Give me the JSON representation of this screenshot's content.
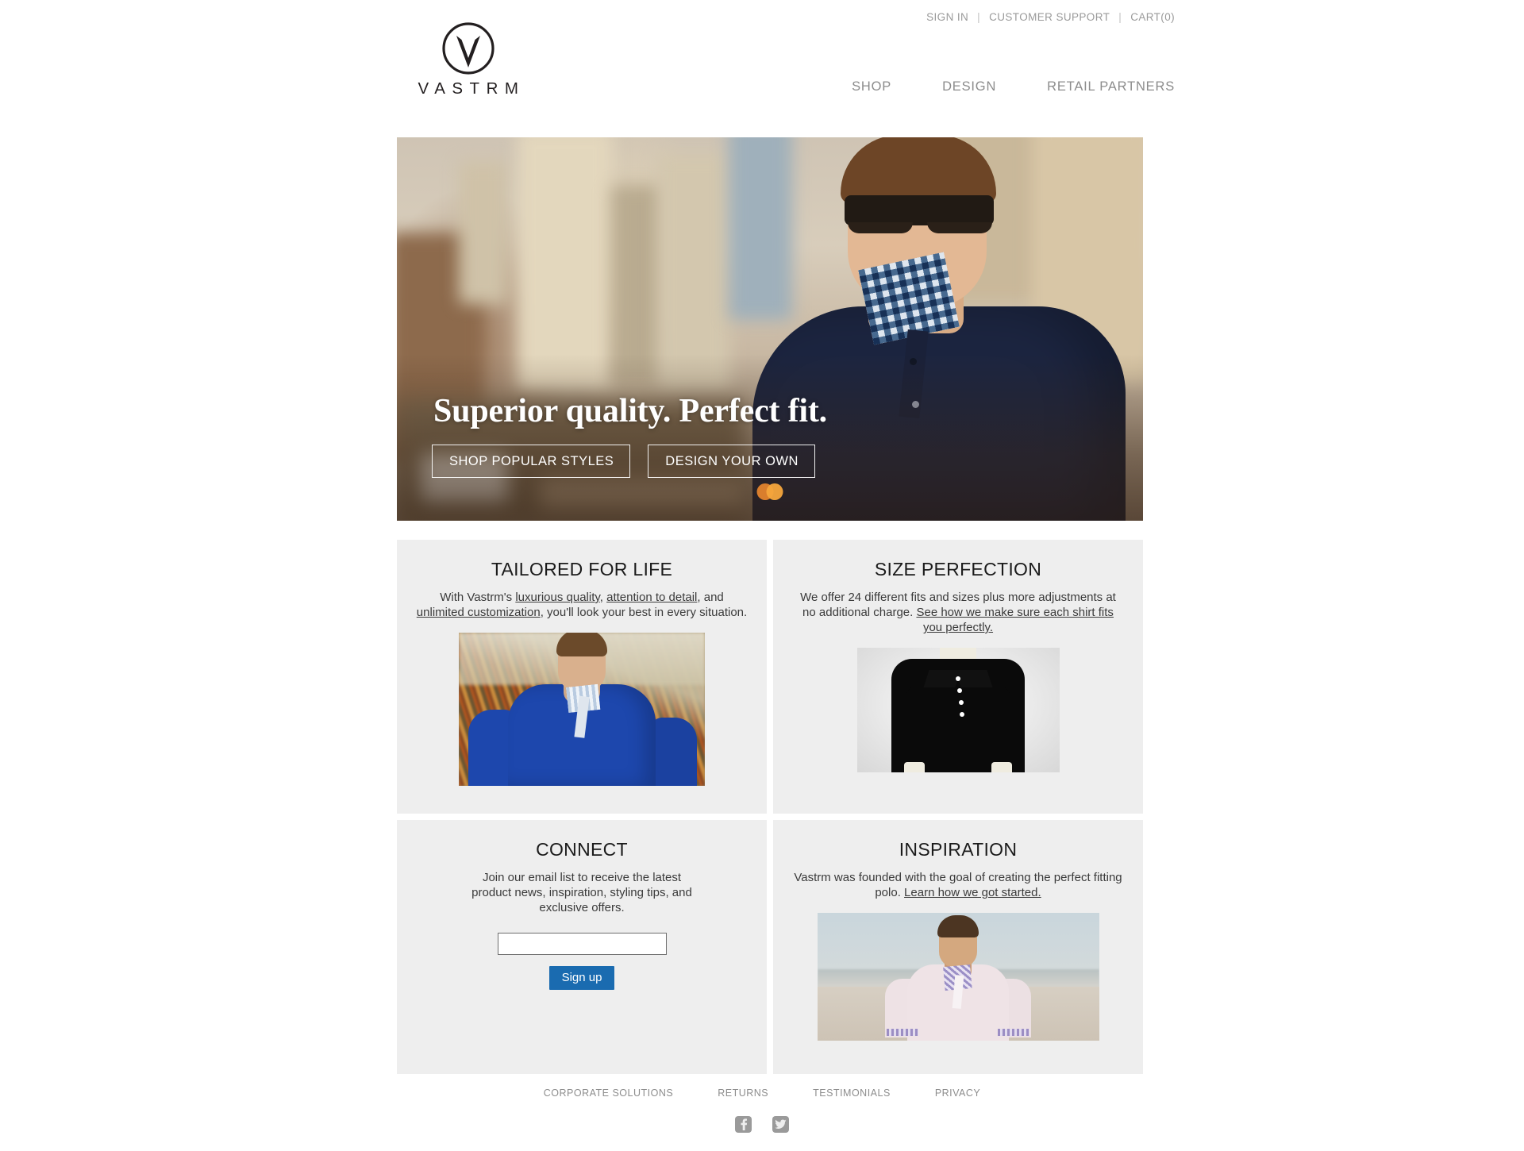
{
  "utility": {
    "sign_in": "SIGN IN",
    "customer_support": "CUSTOMER SUPPORT",
    "cart": "CART(0)",
    "separator": "|"
  },
  "brand": {
    "wordmark": "VASTRM",
    "logo_icon": "circle-v-monogram-icon"
  },
  "nav": {
    "items": [
      {
        "label": "SHOP"
      },
      {
        "label": "DESIGN"
      },
      {
        "label": "RETAIL PARTNERS"
      }
    ]
  },
  "hero": {
    "headline": "Superior quality. Perfect fit.",
    "primary_button": "SHOP POPULAR STYLES",
    "secondary_button": "DESIGN YOUR OWN",
    "image_alt": "man-in-navy-polo-with-gingham-collar-city-street",
    "carousel": {
      "slides": 2,
      "active": 1,
      "dot_color_a": "#e8872e",
      "dot_color_b": "#f5a73c"
    }
  },
  "panels": {
    "tailored": {
      "title": "TAILORED FOR LIFE",
      "body_1": "With Vastrm's ",
      "link_1": "luxurious quality",
      "body_2": ", ",
      "link_2": "attention to detail",
      "body_3": ", and ",
      "link_3": "unlimited customization",
      "body_4": ", you'll look your best in every situation.",
      "image_alt": "man-in-blue-polo-outdoors"
    },
    "size": {
      "title": "SIZE PERFECTION",
      "body_1": "We offer 24 different fits and sizes plus more adjustments at no additional charge. ",
      "link_1": "See how we make sure each shirt fits you perfectly.",
      "image_alt": "black-polo-shirt-on-mannequin"
    },
    "connect": {
      "title": "CONNECT",
      "body": "Join our email list to receive the latest product news, inspiration, styling tips, and exclusive offers.",
      "email_value": "",
      "email_placeholder": "",
      "signup_label": "Sign up",
      "signup_color": "#1a6bb0"
    },
    "inspiration": {
      "title": "INSPIRATION",
      "body_1": "Vastrm was founded with the goal of creating the perfect fitting polo. ",
      "link_1": "Learn how we got started.",
      "image_alt": "man-in-light-pink-polo-on-beach"
    }
  },
  "footer": {
    "links": [
      {
        "label": "CORPORATE SOLUTIONS"
      },
      {
        "label": "RETURNS"
      },
      {
        "label": "TESTIMONIALS"
      },
      {
        "label": "PRIVACY"
      }
    ],
    "social": [
      {
        "name": "facebook-icon",
        "glyph": "f"
      },
      {
        "name": "twitter-icon",
        "glyph": "t"
      }
    ]
  }
}
